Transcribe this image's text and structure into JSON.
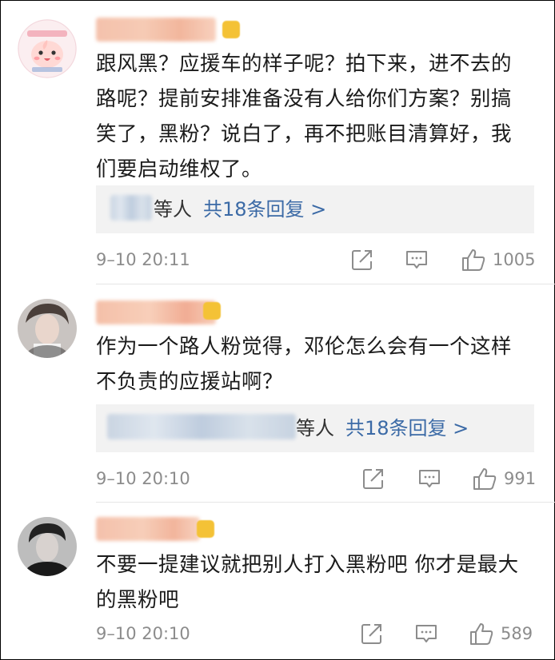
{
  "comments": [
    {
      "text": "跟风黑？应援车的样子呢？拍下来，进不去的路呢？提前安排准备没有人给你们方案？别搞笑了，黑粉？说白了，再不把账目清算好，我们要启动维权了。",
      "reply_suffix": "等人",
      "reply_total": "共18条回复 >",
      "timestamp": "9–10 20:11",
      "likes": "1005",
      "avatar_icon": "peach-mascot-avatar"
    },
    {
      "text": "作为一个路人粉觉得，邓伦怎么会有一个这样不负责的应援站啊？",
      "reply_suffix": "等人",
      "reply_total": "共18条回复 >",
      "timestamp": "9–10 20:10",
      "likes": "991",
      "avatar_icon": "person-photo-avatar"
    },
    {
      "text": "不要一提建议就把别人打入黑粉吧 你才是最大的黑粉吧",
      "timestamp": "9–10 20:10",
      "likes": "589",
      "avatar_icon": "person-photo-avatar"
    }
  ],
  "icons": [
    "share-icon",
    "comment-icon",
    "like-icon"
  ],
  "colors": {
    "link": "#3b6aa6",
    "meta": "#8c8c8c",
    "reply_bg": "#f2f2f2",
    "text": "#1b1b1b"
  }
}
